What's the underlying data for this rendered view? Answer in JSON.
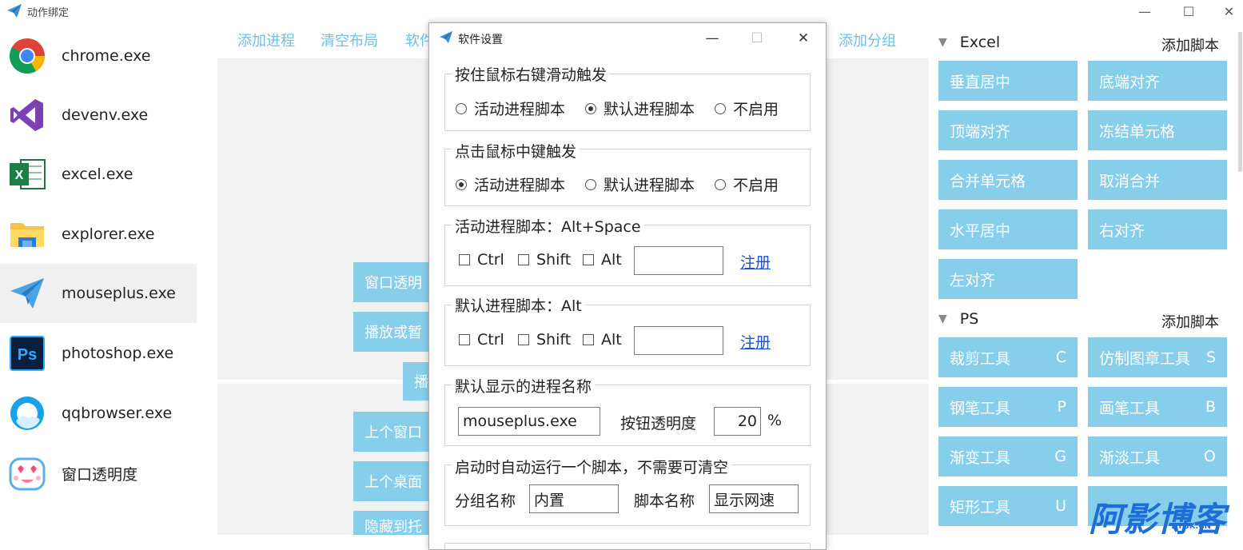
{
  "window": {
    "title": "动作绑定",
    "minimize": "—",
    "maximize": "☐",
    "close": "✕"
  },
  "processes": [
    {
      "label": "chrome.exe",
      "icon": "chrome-icon"
    },
    {
      "label": "devenv.exe",
      "icon": "visual-studio-icon"
    },
    {
      "label": "excel.exe",
      "icon": "excel-icon"
    },
    {
      "label": "explorer.exe",
      "icon": "file-explorer-icon"
    },
    {
      "label": "mouseplus.exe",
      "icon": "paper-plane-icon",
      "selected": true
    },
    {
      "label": "photoshop.exe",
      "icon": "photoshop-icon"
    },
    {
      "label": "qqbrowser.exe",
      "icon": "qqbrowser-icon"
    },
    {
      "label": "窗口透明度",
      "icon": "cute-face-icon"
    }
  ],
  "toolbar": {
    "add_process": "添加进程",
    "clear_layout": "清空布局",
    "software_partial": "软件",
    "add_group": "添加分组"
  },
  "canvas_buttons": {
    "b1": "窗口透明",
    "b2": "播放或暂",
    "b3": "播",
    "b4": "上个窗口",
    "b5": "上个桌面",
    "b6": "隐藏到托"
  },
  "groups": [
    {
      "name": "Excel",
      "add_label": "添加脚本",
      "buttons": [
        {
          "label": "垂直居中",
          "key": ""
        },
        {
          "label": "底端对齐",
          "key": ""
        },
        {
          "label": "顶端对齐",
          "key": ""
        },
        {
          "label": "冻结单元格",
          "key": ""
        },
        {
          "label": "合并单元格",
          "key": ""
        },
        {
          "label": "取消合并",
          "key": ""
        },
        {
          "label": "水平居中",
          "key": ""
        },
        {
          "label": "右对齐",
          "key": ""
        },
        {
          "label": "左对齐",
          "key": ""
        }
      ]
    },
    {
      "name": "PS",
      "add_label": "添加脚本",
      "buttons": [
        {
          "label": "裁剪工具",
          "key": "C"
        },
        {
          "label": "仿制图章工具",
          "key": "S"
        },
        {
          "label": "钢笔工具",
          "key": "P"
        },
        {
          "label": "画笔工具",
          "key": "B"
        },
        {
          "label": "渐变工具",
          "key": "G"
        },
        {
          "label": "渐淡工具",
          "key": "O"
        },
        {
          "label": "矩形工具",
          "key": "U"
        }
      ]
    }
  ],
  "dialog": {
    "title": "软件设置",
    "minimize": "—",
    "maximize": "☐",
    "close": "✕",
    "right_drag": {
      "legend": "按住鼠标右键滑动触发",
      "options": [
        "活动进程脚本",
        "默认进程脚本",
        "不启用"
      ],
      "selected": 1
    },
    "middle_click": {
      "legend": "点击鼠标中键触发",
      "options": [
        "活动进程脚本",
        "默认进程脚本",
        "不启用"
      ],
      "selected": 0
    },
    "active_hotkey": {
      "legend": "活动进程脚本：Alt+Space",
      "ctrl": "Ctrl",
      "shift": "Shift",
      "alt": "Alt",
      "key_value": "",
      "register": "注册"
    },
    "default_hotkey": {
      "legend": "默认进程脚本：Alt",
      "ctrl": "Ctrl",
      "shift": "Shift",
      "alt": "Alt",
      "key_value": "",
      "register": "注册"
    },
    "default_display": {
      "legend": "默认显示的进程名称",
      "process_name": "mouseplus.exe",
      "opacity_label": "按钮透明度",
      "opacity_value": "20",
      "opacity_unit": "%"
    },
    "startup_script": {
      "legend": "启动时自动运行一个脚本，不需要可清空",
      "group_label": "分组名称",
      "group_value": "内置",
      "script_label": "脚本名称",
      "script_value": "显示网速"
    }
  },
  "watermark": {
    "main": "阿影博客",
    "sub": "AYBK.CN"
  }
}
